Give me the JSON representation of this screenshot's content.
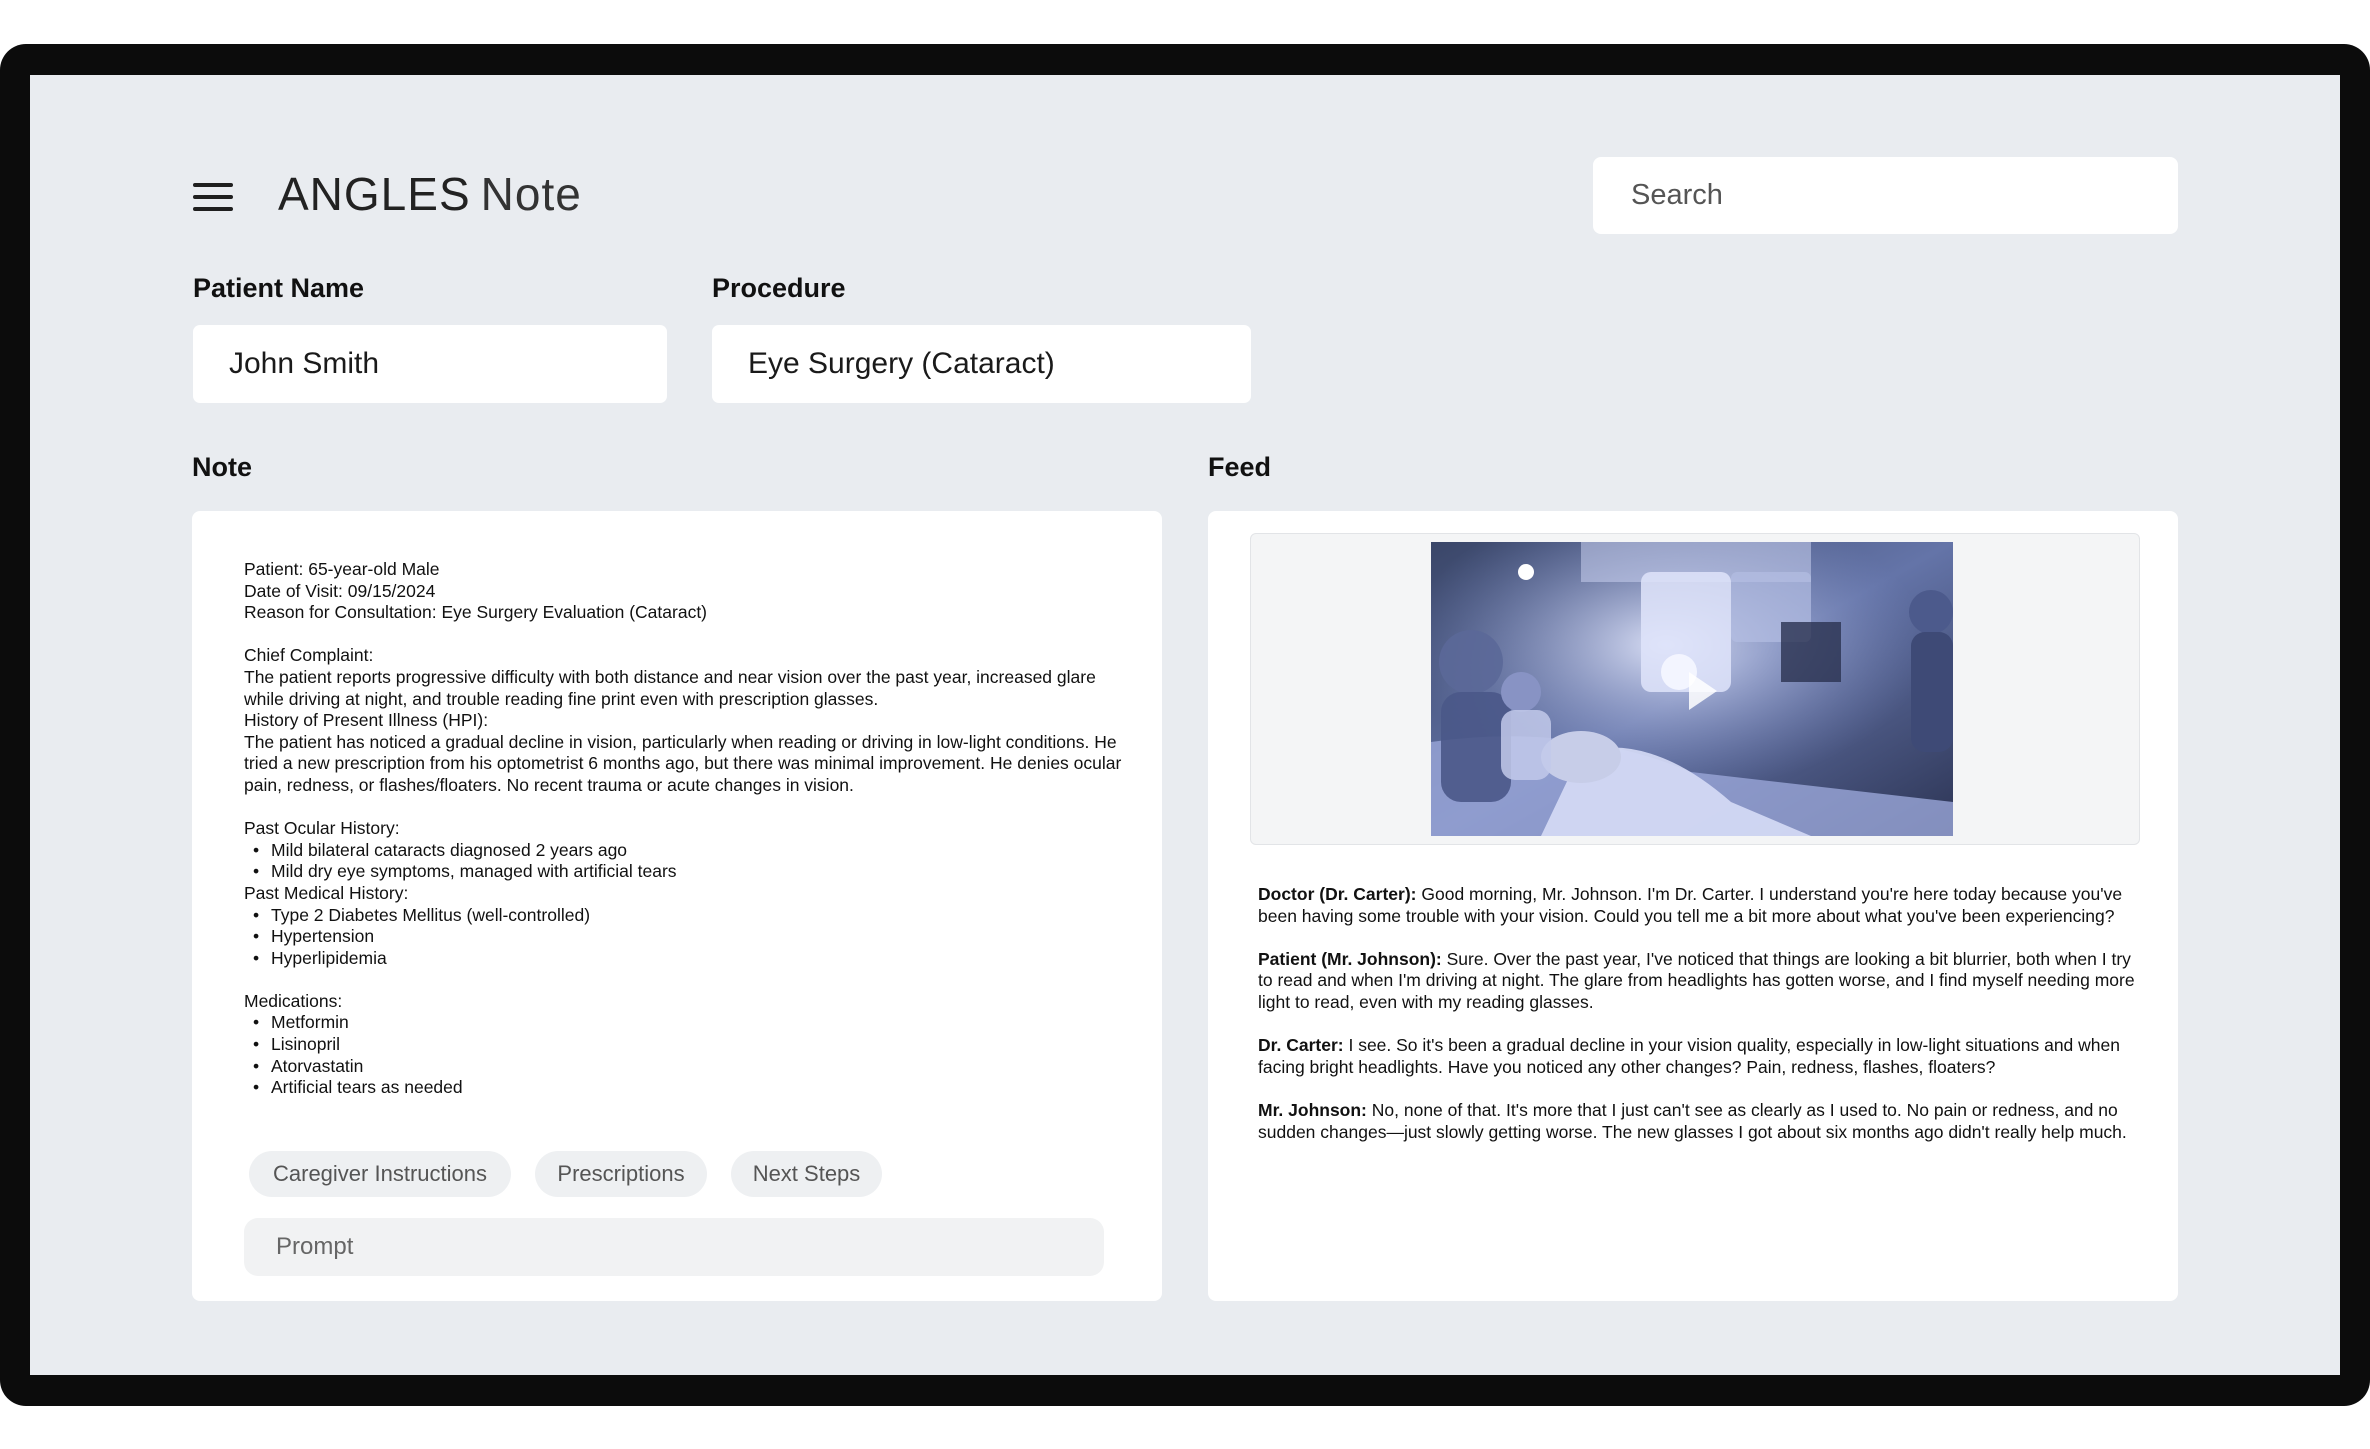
{
  "app": {
    "brand_main": "ANGLES",
    "brand_sub": "Note"
  },
  "search": {
    "placeholder": "Search"
  },
  "fields": {
    "patient_name_label": "Patient Name",
    "patient_name_value": "John Smith",
    "procedure_label": "Procedure",
    "procedure_value": "Eye Surgery (Cataract)"
  },
  "note": {
    "heading": "Note",
    "header_lines": [
      "Patient: 65-year-old Male",
      "Date of Visit: 09/15/2024",
      "Reason for Consultation: Eye Surgery Evaluation (Cataract)"
    ],
    "chief_complaint_title": "Chief Complaint:",
    "chief_complaint_text": "The patient reports progressive difficulty with both distance and near vision over the past year, increased glare while driving at night, and trouble reading fine print even with prescription glasses.",
    "hpi_title": "History of Present Illness (HPI):",
    "hpi_text": "The patient has noticed a gradual decline in vision, particularly when reading or driving in low-light conditions. He tried a new prescription from his optometrist 6 months ago, but there was minimal improvement. He denies ocular pain, redness, or flashes/floaters. No recent trauma or acute changes in vision.",
    "ocular_history_title": "Past Ocular History:",
    "ocular_history": [
      "Mild bilateral cataracts diagnosed 2 years ago",
      "Mild dry eye symptoms, managed with artificial tears"
    ],
    "medical_history_title": "Past Medical History:",
    "medical_history": [
      "Type 2 Diabetes Mellitus (well-controlled)",
      "Hypertension",
      "Hyperlipidemia"
    ],
    "medications_title": "Medications:",
    "medications": [
      "Metformin",
      "Lisinopril",
      "Atorvastatin",
      "Artificial tears as needed"
    ],
    "chips": [
      "Caregiver Instructions",
      "Prescriptions",
      "Next Steps"
    ],
    "prompt_placeholder": "Prompt"
  },
  "feed": {
    "heading": "Feed",
    "transcript": [
      {
        "speaker": "Doctor (Dr. Carter):",
        "text": "Good morning, Mr. Johnson. I'm Dr. Carter. I understand you're here today because you've been having some trouble with your vision. Could you tell me a bit more about what you've been experiencing?"
      },
      {
        "speaker": "Patient (Mr. Johnson):",
        "text": "Sure. Over the past year, I've noticed that things are looking a bit blurrier, both when I try to read and when I'm driving at night. The glare from headlights has gotten worse, and I find myself needing more light to read, even with my reading glasses."
      },
      {
        "speaker": "Dr. Carter:",
        "text": "I see. So it's been a gradual decline in your vision quality, especially in low-light situations and when facing bright headlights. Have you noticed any other changes? Pain, redness, flashes, floaters?"
      },
      {
        "speaker": "Mr. Johnson:",
        "text": "No, none of that. It's more that I just can't see as clearly as I used to. No pain or redness, and no sudden changes—just slowly getting worse. The new glasses I got about six months ago didn't really help much."
      }
    ]
  }
}
